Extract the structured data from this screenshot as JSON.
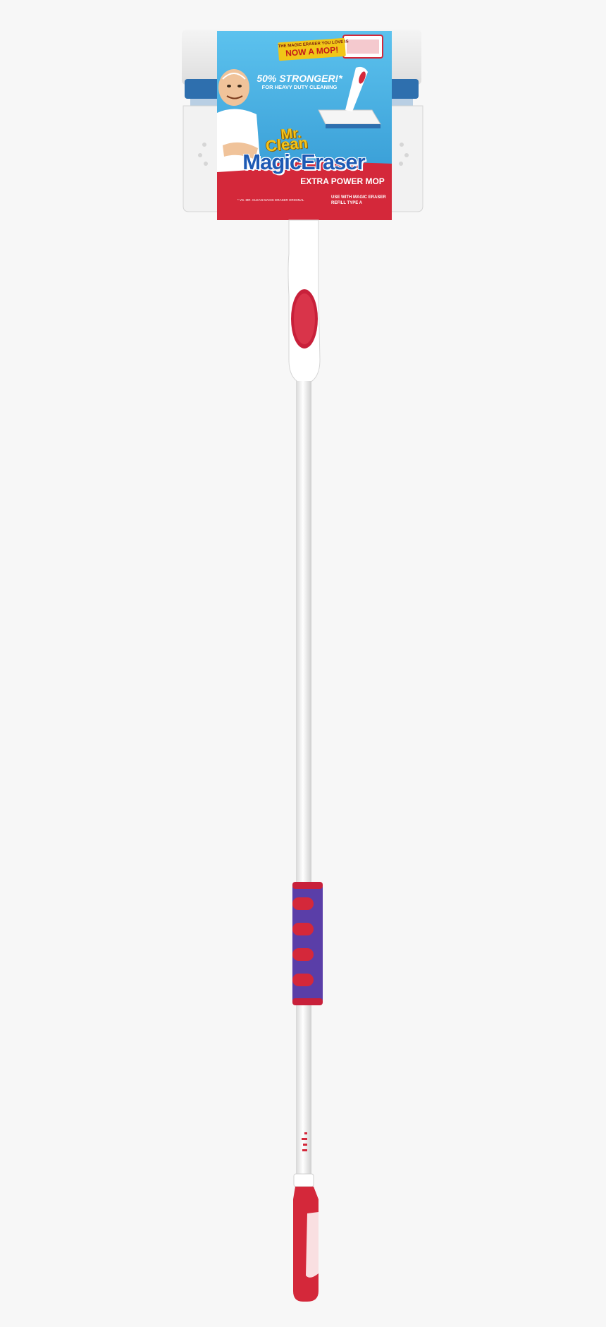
{
  "package": {
    "badge_small": "THE MAGIC ERASER YOU LOVE IS",
    "badge_big": "NOW A MOP!",
    "claim": "50% STRONGER!*",
    "claim_sub": "FOR HEAVY DUTY CLEANING",
    "brand_line1": "Mr.",
    "brand_line2": "Clean",
    "brand_line3": "MagicEraser",
    "product_name": "EXTRA POWER MOP",
    "footnote": "* VS. MR. CLEAN MAGIC ERASER ORIGINAL",
    "refill_line1": "USE WITH MAGIC ERASER",
    "refill_line2": "REFILL TYPE A"
  },
  "colors": {
    "background": "#f7f7f7",
    "sky_blue": "#3da8dc",
    "brand_red": "#d4283a",
    "grip_purple": "#5a3ea8",
    "handle_white": "#ffffff",
    "pole_gray": "#e9e9e9",
    "sponge_blue": "#2e6fae",
    "badge_yellow": "#f1c617"
  }
}
